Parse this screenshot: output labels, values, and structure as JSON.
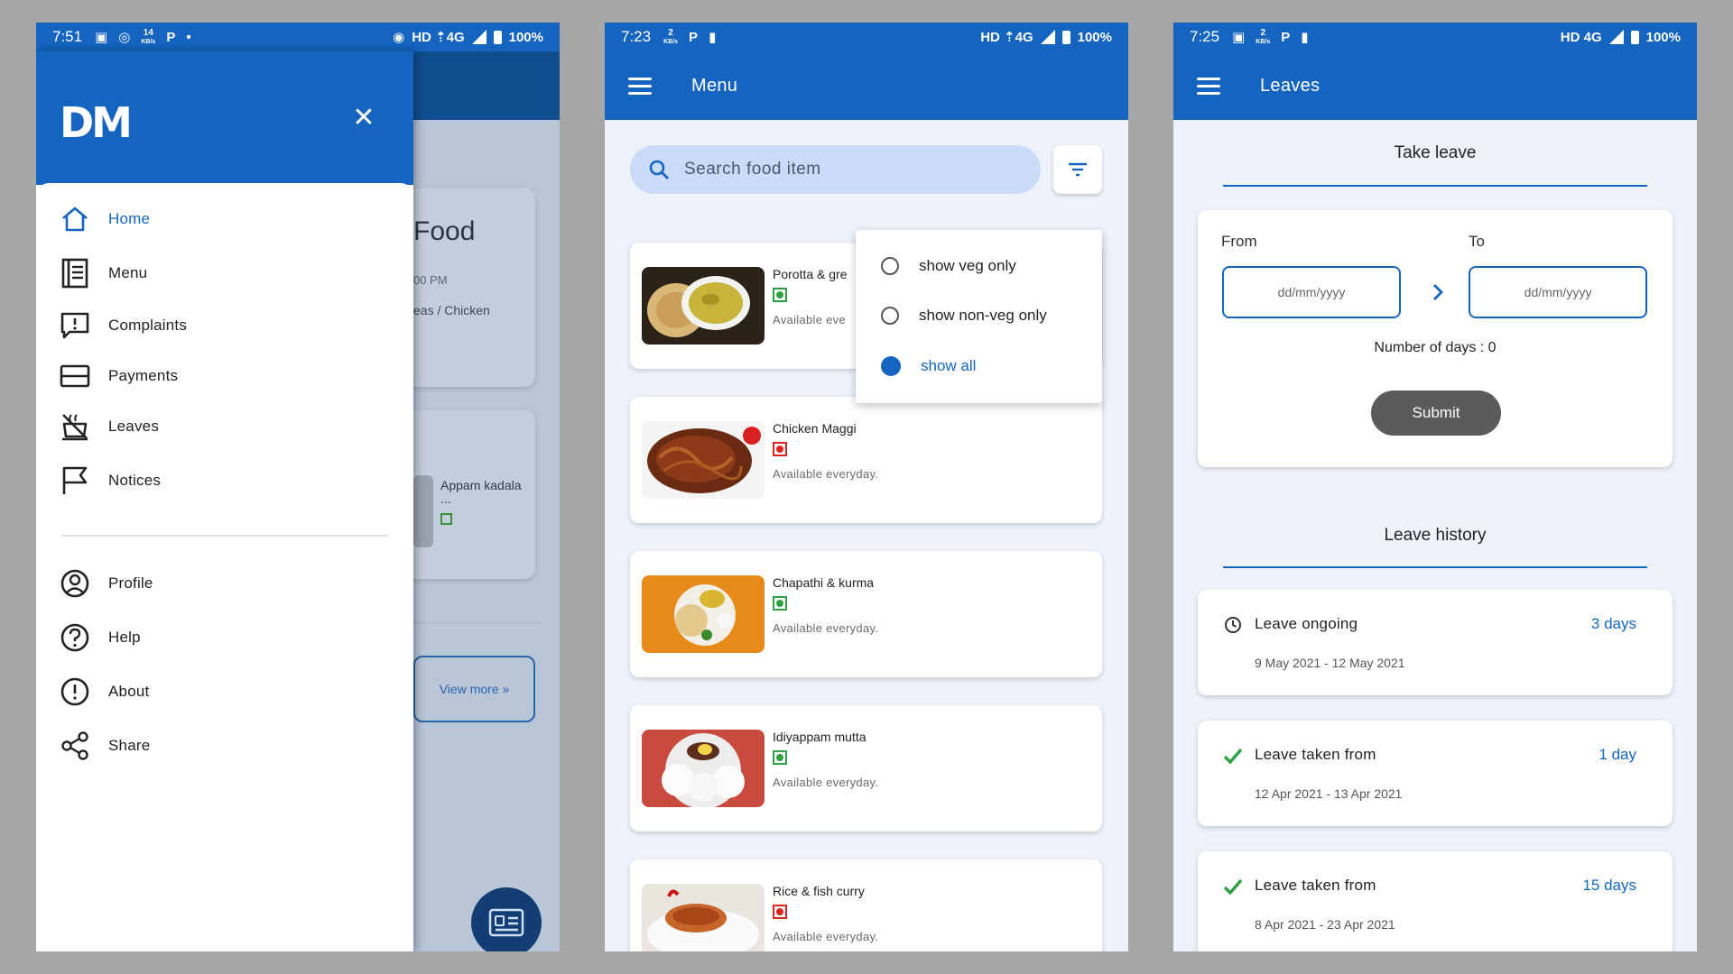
{
  "phone1": {
    "status": {
      "time": "7:51",
      "speed_top": "14",
      "speed_unit": "KB/s",
      "network": "HD ⇡4G",
      "battery": "100%"
    },
    "background": {
      "card_title": "Food",
      "card_time": "00 PM",
      "card_desc": "eas / Chicken",
      "appam": "Appam kadala ...",
      "view_more": "View more »"
    },
    "drawer": {
      "logo": "DM",
      "items": [
        {
          "label": "Home",
          "icon": "home-icon"
        },
        {
          "label": "Menu",
          "icon": "menu-book-icon"
        },
        {
          "label": "Complaints",
          "icon": "complaint-icon"
        },
        {
          "label": "Payments",
          "icon": "payment-card-icon"
        },
        {
          "label": "Leaves",
          "icon": "leaves-icon"
        },
        {
          "label": "Notices",
          "icon": "flag-icon"
        }
      ],
      "secondary": [
        {
          "label": "Profile",
          "icon": "profile-icon"
        },
        {
          "label": "Help",
          "icon": "help-icon"
        },
        {
          "label": "About",
          "icon": "about-icon"
        },
        {
          "label": "Share",
          "icon": "share-icon"
        }
      ]
    }
  },
  "phone2": {
    "status": {
      "time": "7:23",
      "speed_top": "2",
      "speed_unit": "KB/s",
      "network": "HD ⇡4G",
      "battery": "100%"
    },
    "title": "Menu",
    "search_placeholder": "Search food item",
    "items": [
      {
        "name": "Porotta & gre",
        "veg": true,
        "availability": "Available eve"
      },
      {
        "name": "Chicken Maggi",
        "veg": false,
        "availability": "Available everyday."
      },
      {
        "name": "Chapathi & kurma",
        "veg": true,
        "availability": "Available everyday."
      },
      {
        "name": "Idiyappam mutta",
        "veg": true,
        "availability": "Available everyday."
      },
      {
        "name": "Rice & fish curry",
        "veg": false,
        "availability": "Available everyday."
      }
    ],
    "filter_options": [
      "show veg only",
      "show non-veg only",
      "show all"
    ],
    "filter_selected": "show all"
  },
  "phone3": {
    "status": {
      "time": "7:25",
      "speed_top": "2",
      "speed_unit": "KB/s",
      "network": "HD 4G",
      "battery": "100%"
    },
    "title": "Leaves",
    "take_leave": {
      "title": "Take leave",
      "from_label": "From",
      "to_label": "To",
      "from_placeholder": "dd/mm/yyyy",
      "to_placeholder": "dd/mm/yyyy",
      "days_text": "Number of days : 0",
      "submit": "Submit"
    },
    "history_title": "Leave history",
    "history": [
      {
        "title": "Leave ongoing",
        "days": "3 days",
        "range": "9 May 2021 - 12 May 2021",
        "status": "ongoing"
      },
      {
        "title": "Leave taken from",
        "days": "1 day",
        "range": "12 Apr 2021 - 13 Apr 2021",
        "status": "taken"
      },
      {
        "title": "Leave taken from",
        "days": "15 days",
        "range": "8 Apr 2021 - 23 Apr 2021",
        "status": "taken"
      }
    ]
  },
  "colors": {
    "primary": "#1565c0",
    "veg": "#2ea043",
    "nonveg": "#e02424",
    "submit": "#5b5b5b"
  }
}
